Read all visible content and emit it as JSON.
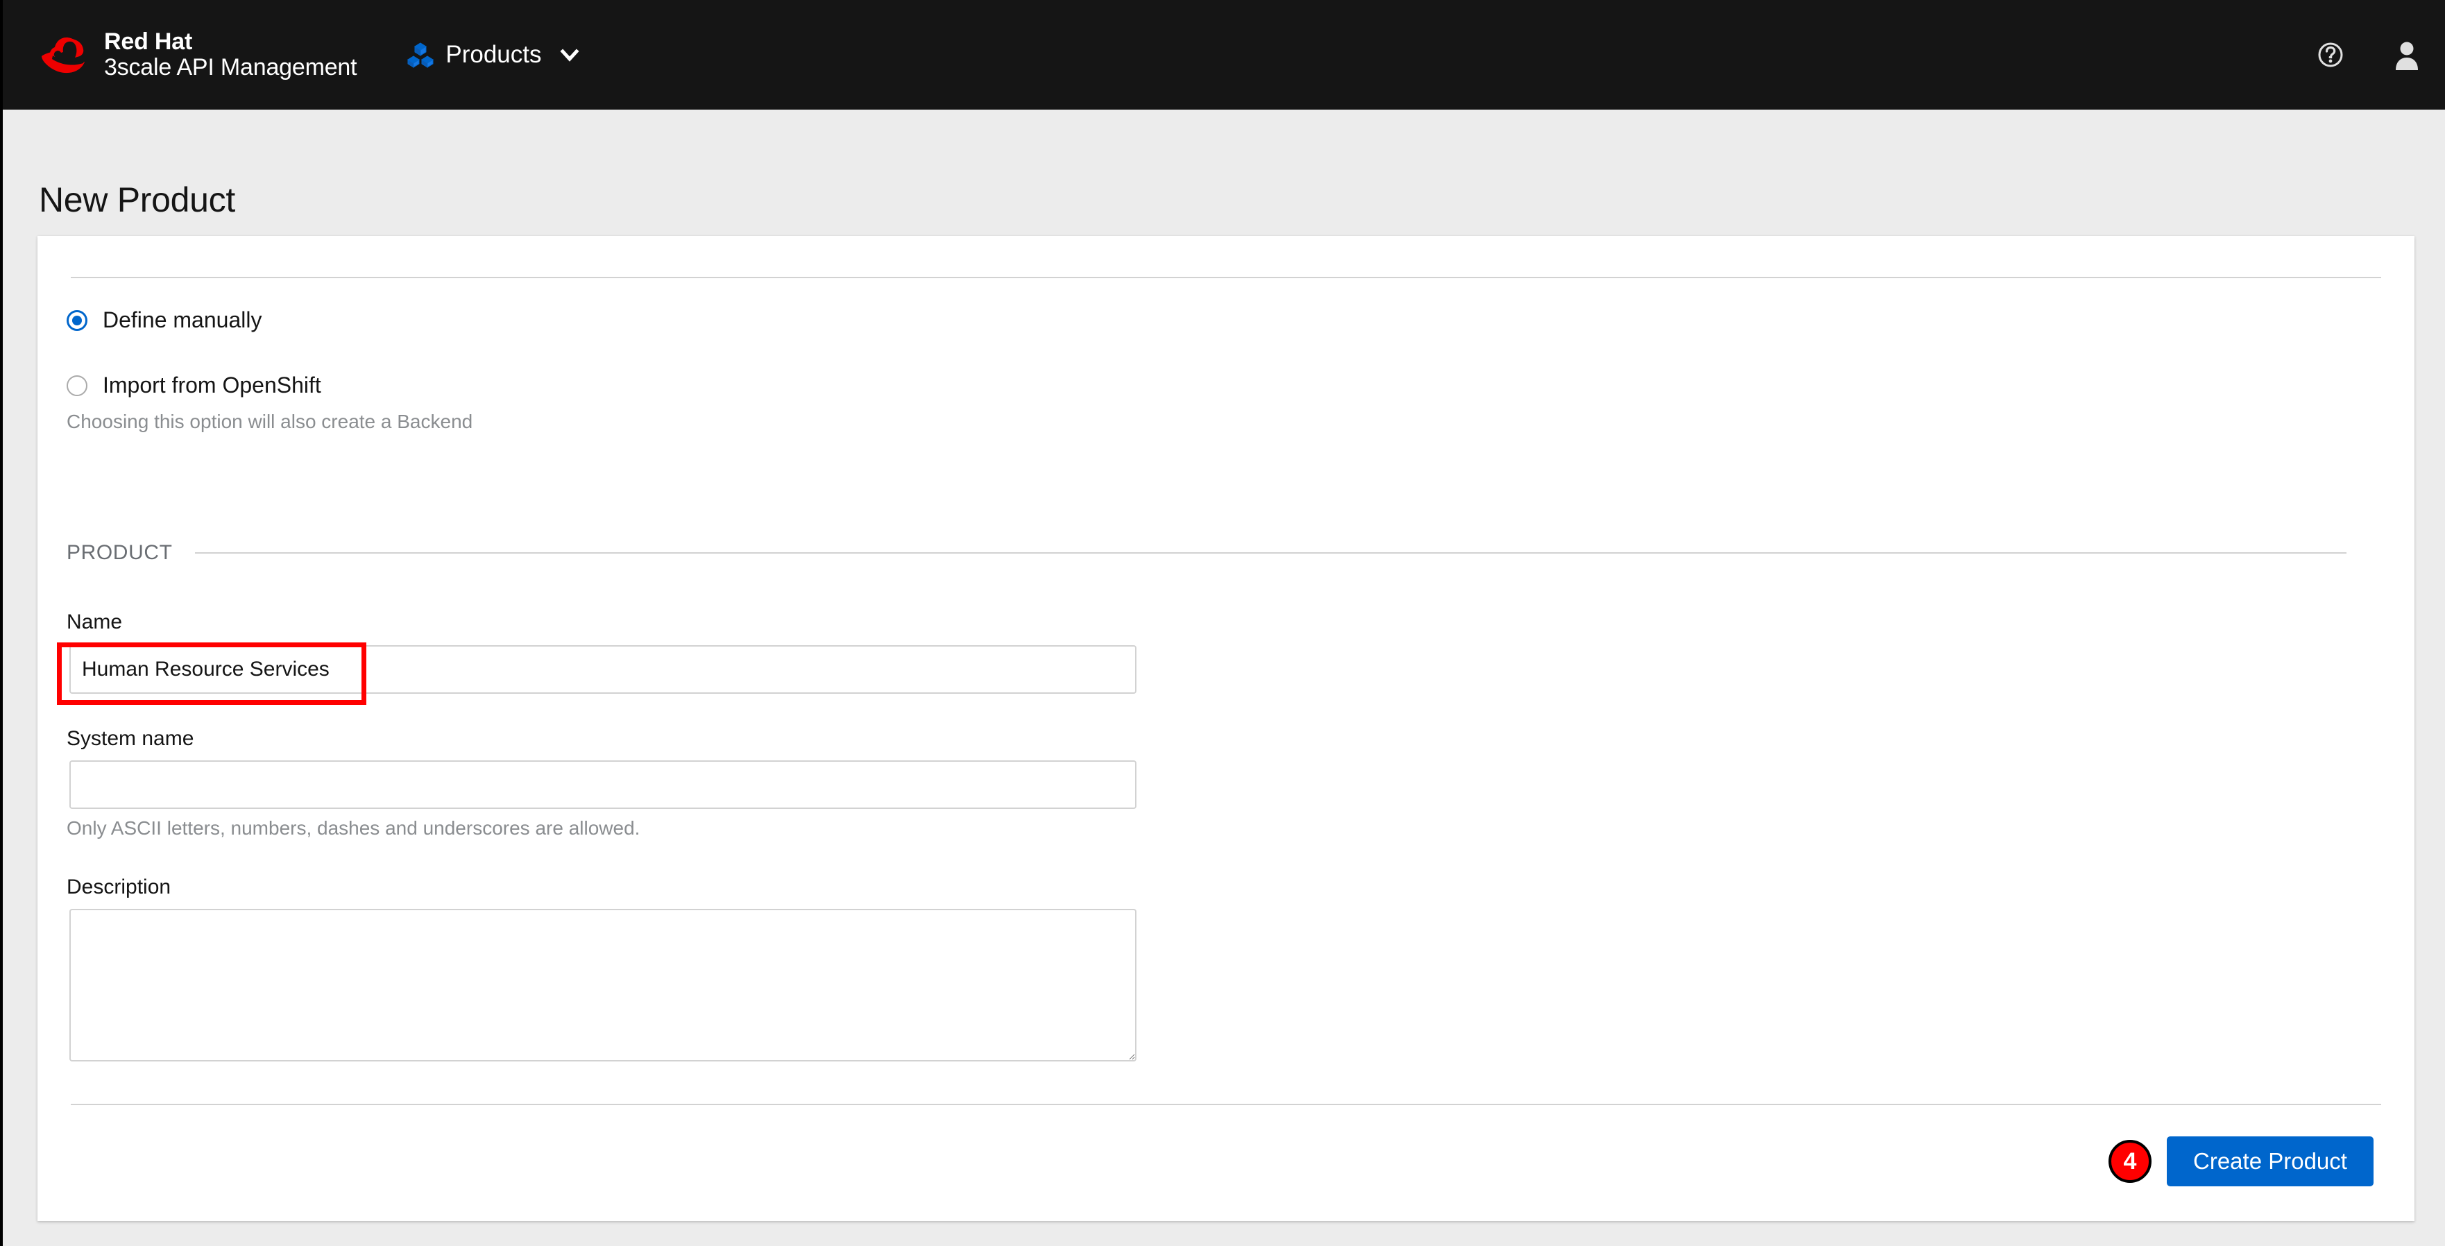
{
  "masthead": {
    "logo_icon": "red-hat-fedora-logo",
    "brand_line1": "Red Hat",
    "brand_line2": "3scale API Management",
    "nav": {
      "icon": "cubes-icon",
      "label": "Products",
      "chevron_icon": "chevron-down-icon"
    },
    "help_icon": "help-circle-icon",
    "user_icon": "user-avatar-icon",
    "background": "#151515",
    "accent": "#0066cc"
  },
  "page": {
    "title": "New Product",
    "background": "#ececec"
  },
  "form": {
    "source_options": [
      {
        "label": "Define manually",
        "selected": true
      },
      {
        "label": "Import from OpenShift",
        "selected": false
      }
    ],
    "openshift_helper": "Choosing this option will also create a Backend",
    "section_title": "PRODUCT",
    "fields": {
      "name": {
        "label": "Name",
        "value": "Human Resource Services",
        "placeholder": ""
      },
      "system_name": {
        "label": "System name",
        "value": "",
        "placeholder": "",
        "helper": "Only ASCII letters, numbers, dashes and underscores are allowed."
      },
      "description": {
        "label": "Description",
        "value": "",
        "placeholder": ""
      }
    }
  },
  "actions": {
    "step_badge": "4",
    "step_badge_color": "#ff0000",
    "submit_label": "Create Product",
    "submit_color": "#0066cc"
  },
  "annotation": {
    "highlight_color": "#ff0000",
    "target": "name-input"
  }
}
